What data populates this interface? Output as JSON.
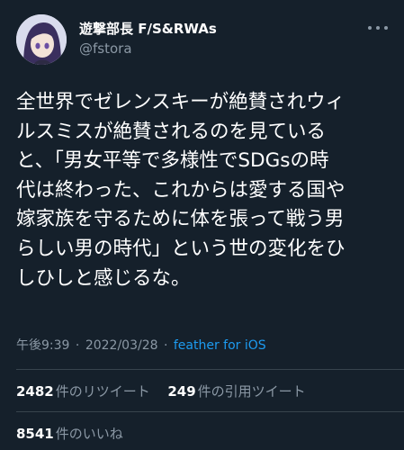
{
  "author": {
    "display_name": "遊撃部長 F/S&RWAs",
    "handle": "@fstora"
  },
  "tweet": {
    "lines": [
      "全世界でゼレンスキーが絶賛されウィ",
      "ルスミスが絶賛されるのを見ている",
      "と、「男女平等で多様性でSDGsの時",
      "代は終わった、これからは愛する国や",
      "嫁家族を守るために体を張って戦う男",
      "らしい男の時代」という世の変化をひ",
      "しひしと感じるな。"
    ],
    "time": "午後9:39",
    "separator": "·",
    "date": "2022/03/28",
    "app": "feather for iOS"
  },
  "stats": {
    "retweets": "2482",
    "retweets_label": "件のリツイート",
    "quotes": "249",
    "quotes_label": "件の引用ツイート",
    "likes": "8541",
    "likes_label": "件のいいね"
  },
  "colors": {
    "background": "#15202b",
    "secondary_text": "#8b98a5",
    "link": "#1d9bf0",
    "divider": "#38444d"
  },
  "icons": [
    "avatar-image",
    "more-options-icon"
  ]
}
